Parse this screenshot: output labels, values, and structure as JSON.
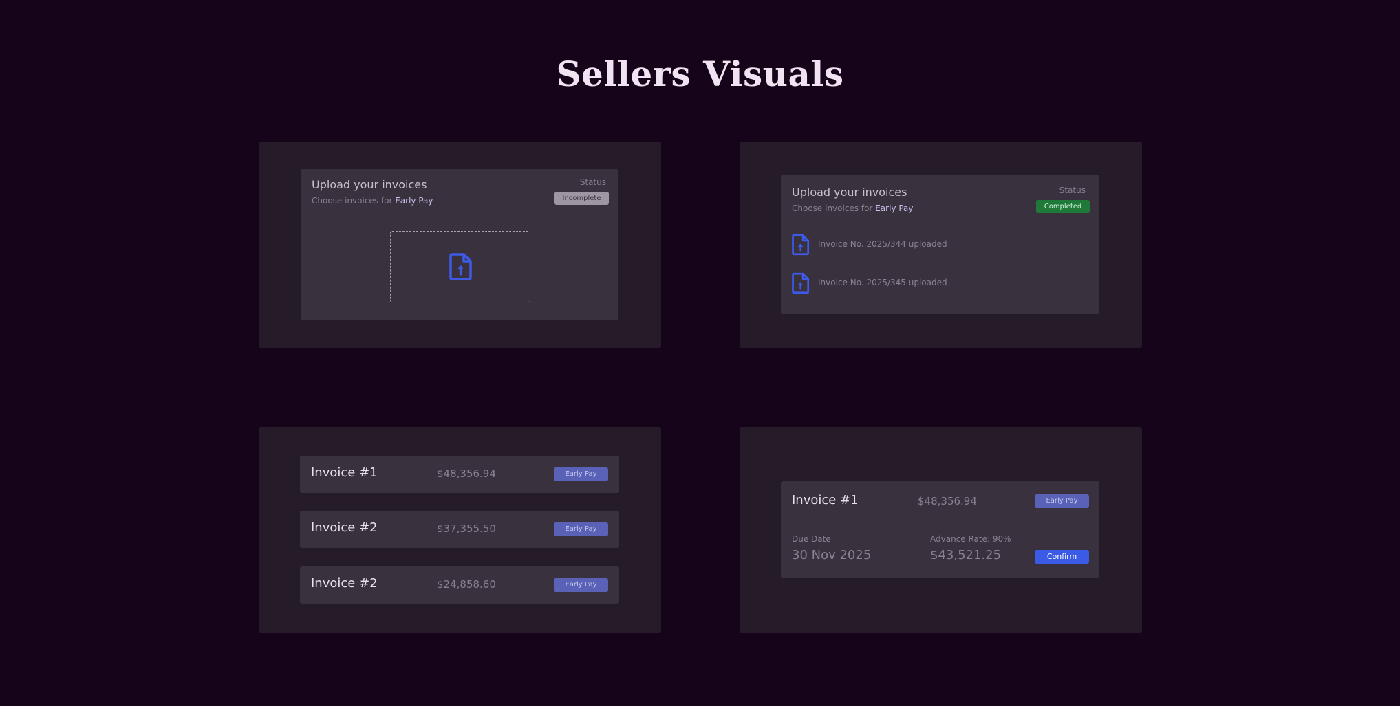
{
  "page": {
    "title": "Sellers Visuals"
  },
  "colors": {
    "background": "#16051a",
    "panel": "#261b29",
    "card": "#3a313f",
    "accent_icon": "#3d5be8",
    "early_pay_button": "#5a62b8",
    "confirm_button": "#3b5be6",
    "completed_badge": "#1f7a3a",
    "incomplete_badge": "#9e97a3"
  },
  "upload_incomplete": {
    "title": "Upload your invoices",
    "subtitle_prefix": "Choose invoices for",
    "subtitle_highlight": "Early Pay",
    "status_label": "Status",
    "status_badge": "Incomplete",
    "dropzone_icon": "file-upload-icon"
  },
  "upload_completed": {
    "title": "Upload your invoices",
    "subtitle_prefix": "Choose invoices for",
    "subtitle_highlight": "Early Pay",
    "status_label": "Status",
    "status_badge": "Completed",
    "files": [
      {
        "icon": "file-upload-icon",
        "text": "Invoice No. 2025/344 uploaded"
      },
      {
        "icon": "file-upload-icon",
        "text": "Invoice No. 2025/345 uploaded"
      }
    ]
  },
  "invoice_list": {
    "rows": [
      {
        "name": "Invoice #1",
        "amount": "$48,356.94",
        "button": "Early Pay"
      },
      {
        "name": "Invoice #2",
        "amount": "$37,355.50",
        "button": "Early Pay"
      },
      {
        "name": "Invoice #2",
        "amount": "$24,858.60",
        "button": "Early Pay"
      }
    ]
  },
  "invoice_detail": {
    "name": "Invoice #1",
    "amount": "$48,356.94",
    "button": "Early Pay",
    "due_date_label": "Due Date",
    "due_date_value": "30 Nov 2025",
    "advance_rate_label": "Advance Rate: 90%",
    "advance_amount": "$43,521.25",
    "confirm_label": "Confirm"
  }
}
